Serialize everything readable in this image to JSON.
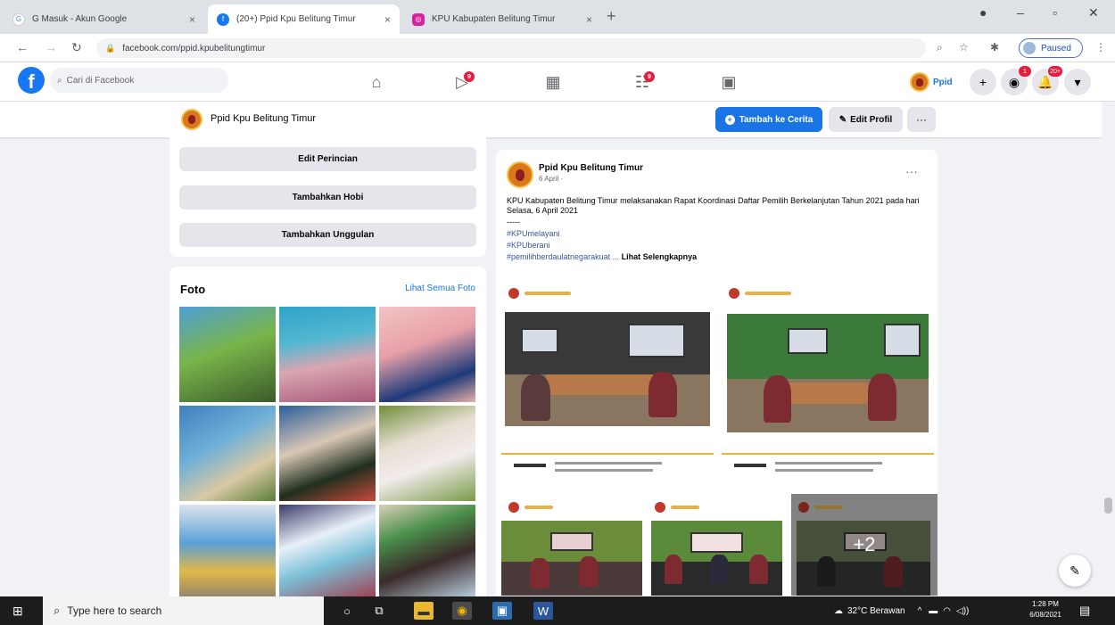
{
  "browser": {
    "tabs": [
      {
        "label": "G Masuk - Akun Google",
        "icon": "google-icon",
        "active": false
      },
      {
        "label": "(20+) Ppid Kpu Belitung Timur",
        "icon": "facebook-icon",
        "active": true
      },
      {
        "label": "KPU Kabupaten Belitung Timur",
        "icon": "instagram-icon",
        "active": false
      }
    ],
    "url": "facebook.com/ppid.kpubelitungtimur",
    "profile_label": "Paused"
  },
  "fb_nav": {
    "search_placeholder": "Cari di Facebook",
    "profile_name": "Ppid",
    "notification_badge": "20+",
    "icons": [
      "home-icon",
      "watch-icon",
      "marketplace-icon",
      "groups-icon",
      "gaming-icon"
    ]
  },
  "profile_bar": {
    "page_name": "Ppid Kpu Belitung Timur",
    "add_story_label": "Tambah ke Cerita",
    "edit_profile_label": "Edit Profil",
    "more_label": "···"
  },
  "intro": {
    "buttons": [
      "Edit Perincian",
      "Tambahkan Hobi",
      "Tambahkan Unggulan"
    ]
  },
  "photos": {
    "title": "Foto",
    "see_all": "Lihat Semua Foto"
  },
  "post": {
    "author": "Ppid Kpu Belitung Timur",
    "date": "6 April ·",
    "text": "KPU Kabupaten Belitung Timur melaksanakan Rapat Koordinasi Daftar Pemilih Berkelanjutan Tahun 2021 pada hari Selasa, 6 April 2021",
    "separator": "-----",
    "hashtags": [
      "#KPUmelayani",
      "#KPUberani"
    ],
    "hashtag3": "#pemilihberdaulatnegarakuat",
    "see_more": "Lihat Selengkapnya",
    "more_photos": "+2"
  },
  "taskbar": {
    "search_placeholder": "Type here to search",
    "weather": "32°C Berawan",
    "time": "1:28 PM",
    "date": "6/08/2021"
  },
  "colors": {
    "fb_blue": "#1877f2",
    "button_blue": "#1b74e4",
    "badge_red": "#e41e3f",
    "kpu_maroon": "#7d2b31"
  }
}
